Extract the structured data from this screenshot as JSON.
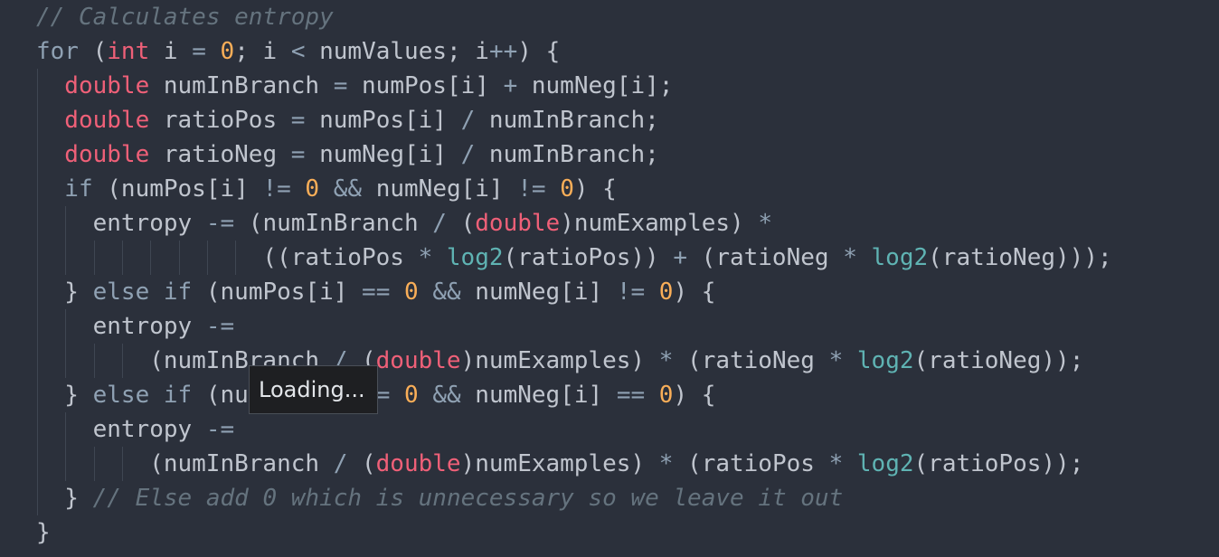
{
  "editor": {
    "colors": {
      "background": "#2b303b",
      "text": "#c0c5ce",
      "keyword": "#8fa1b3",
      "type": "#ef6078",
      "number": "#f9ae58",
      "operator": "#8fa1b3",
      "function": "#5fb3b3",
      "comment": "#65737e"
    },
    "lines": [
      {
        "indent": 0,
        "tokens": [
          {
            "t": "comment",
            "v": "// Calculates entropy"
          }
        ]
      },
      {
        "indent": 0,
        "tokens": [
          {
            "t": "kw",
            "v": "for"
          },
          {
            "t": "text",
            "v": " ("
          },
          {
            "t": "type",
            "v": "int"
          },
          {
            "t": "text",
            "v": " i "
          },
          {
            "t": "op",
            "v": "="
          },
          {
            "t": "text",
            "v": " "
          },
          {
            "t": "num",
            "v": "0"
          },
          {
            "t": "text",
            "v": "; i "
          },
          {
            "t": "op",
            "v": "<"
          },
          {
            "t": "text",
            "v": " numValues; i"
          },
          {
            "t": "op",
            "v": "++"
          },
          {
            "t": "text",
            "v": ") {"
          }
        ]
      },
      {
        "indent": 1,
        "tokens": [
          {
            "t": "type",
            "v": "double"
          },
          {
            "t": "text",
            "v": " numInBranch "
          },
          {
            "t": "op",
            "v": "="
          },
          {
            "t": "text",
            "v": " numPos[i] "
          },
          {
            "t": "op",
            "v": "+"
          },
          {
            "t": "text",
            "v": " numNeg[i];"
          }
        ]
      },
      {
        "indent": 1,
        "tokens": [
          {
            "t": "type",
            "v": "double"
          },
          {
            "t": "text",
            "v": " ratioPos "
          },
          {
            "t": "op",
            "v": "="
          },
          {
            "t": "text",
            "v": " numPos[i] "
          },
          {
            "t": "op",
            "v": "/"
          },
          {
            "t": "text",
            "v": " numInBranch;"
          }
        ]
      },
      {
        "indent": 1,
        "tokens": [
          {
            "t": "type",
            "v": "double"
          },
          {
            "t": "text",
            "v": " ratioNeg "
          },
          {
            "t": "op",
            "v": "="
          },
          {
            "t": "text",
            "v": " numNeg[i] "
          },
          {
            "t": "op",
            "v": "/"
          },
          {
            "t": "text",
            "v": " numInBranch;"
          }
        ]
      },
      {
        "indent": 1,
        "tokens": [
          {
            "t": "kw",
            "v": "if"
          },
          {
            "t": "text",
            "v": " (numPos[i] "
          },
          {
            "t": "op",
            "v": "!="
          },
          {
            "t": "text",
            "v": " "
          },
          {
            "t": "num",
            "v": "0"
          },
          {
            "t": "text",
            "v": " "
          },
          {
            "t": "op",
            "v": "&&"
          },
          {
            "t": "text",
            "v": " numNeg[i] "
          },
          {
            "t": "op",
            "v": "!="
          },
          {
            "t": "text",
            "v": " "
          },
          {
            "t": "num",
            "v": "0"
          },
          {
            "t": "text",
            "v": ") {"
          }
        ]
      },
      {
        "indent": 2,
        "tokens": [
          {
            "t": "text",
            "v": "entropy "
          },
          {
            "t": "op",
            "v": "-="
          },
          {
            "t": "text",
            "v": " (numInBranch "
          },
          {
            "t": "op",
            "v": "/"
          },
          {
            "t": "text",
            "v": " ("
          },
          {
            "t": "type",
            "v": "double"
          },
          {
            "t": "text",
            "v": ")numExamples) "
          },
          {
            "t": "op",
            "v": "*"
          }
        ]
      },
      {
        "indent": 8,
        "tokens": [
          {
            "t": "text",
            "v": "((ratioPos "
          },
          {
            "t": "op",
            "v": "*"
          },
          {
            "t": "text",
            "v": " "
          },
          {
            "t": "fn",
            "v": "log2"
          },
          {
            "t": "text",
            "v": "(ratioPos)) "
          },
          {
            "t": "op",
            "v": "+"
          },
          {
            "t": "text",
            "v": " (ratioNeg "
          },
          {
            "t": "op",
            "v": "*"
          },
          {
            "t": "text",
            "v": " "
          },
          {
            "t": "fn",
            "v": "log2"
          },
          {
            "t": "text",
            "v": "(ratioNeg)));"
          }
        ]
      },
      {
        "indent": 1,
        "tokens": [
          {
            "t": "text",
            "v": "} "
          },
          {
            "t": "kw",
            "v": "else"
          },
          {
            "t": "text",
            "v": " "
          },
          {
            "t": "kw",
            "v": "if"
          },
          {
            "t": "text",
            "v": " (numPos[i] "
          },
          {
            "t": "op",
            "v": "=="
          },
          {
            "t": "text",
            "v": " "
          },
          {
            "t": "num",
            "v": "0"
          },
          {
            "t": "text",
            "v": " "
          },
          {
            "t": "op",
            "v": "&&"
          },
          {
            "t": "text",
            "v": " numNeg[i] "
          },
          {
            "t": "op",
            "v": "!="
          },
          {
            "t": "text",
            "v": " "
          },
          {
            "t": "num",
            "v": "0"
          },
          {
            "t": "text",
            "v": ") {"
          }
        ]
      },
      {
        "indent": 2,
        "tokens": [
          {
            "t": "text",
            "v": "entropy "
          },
          {
            "t": "op",
            "v": "-="
          }
        ]
      },
      {
        "indent": 4,
        "tokens": [
          {
            "t": "text",
            "v": "(numInBranch "
          },
          {
            "t": "op",
            "v": "/"
          },
          {
            "t": "text",
            "v": " ("
          },
          {
            "t": "type",
            "v": "double"
          },
          {
            "t": "text",
            "v": ")numExamples) "
          },
          {
            "t": "op",
            "v": "*"
          },
          {
            "t": "text",
            "v": " (ratioNeg "
          },
          {
            "t": "op",
            "v": "*"
          },
          {
            "t": "text",
            "v": " "
          },
          {
            "t": "fn",
            "v": "log2"
          },
          {
            "t": "text",
            "v": "(ratioNeg));"
          }
        ]
      },
      {
        "indent": 1,
        "tokens": [
          {
            "t": "text",
            "v": "} "
          },
          {
            "t": "kw",
            "v": "else"
          },
          {
            "t": "text",
            "v": " "
          },
          {
            "t": "kw",
            "v": "if"
          },
          {
            "t": "text",
            "v": " (numPos[i] "
          },
          {
            "t": "op",
            "v": "!="
          },
          {
            "t": "text",
            "v": " "
          },
          {
            "t": "num",
            "v": "0"
          },
          {
            "t": "text",
            "v": " "
          },
          {
            "t": "op",
            "v": "&&"
          },
          {
            "t": "text",
            "v": " numNeg[i] "
          },
          {
            "t": "op",
            "v": "=="
          },
          {
            "t": "text",
            "v": " "
          },
          {
            "t": "num",
            "v": "0"
          },
          {
            "t": "text",
            "v": ") {"
          }
        ]
      },
      {
        "indent": 2,
        "tokens": [
          {
            "t": "text",
            "v": "entropy "
          },
          {
            "t": "op",
            "v": "-="
          }
        ]
      },
      {
        "indent": 4,
        "tokens": [
          {
            "t": "text",
            "v": "(numInBranch "
          },
          {
            "t": "op",
            "v": "/"
          },
          {
            "t": "text",
            "v": " ("
          },
          {
            "t": "type",
            "v": "double"
          },
          {
            "t": "text",
            "v": ")numExamples) "
          },
          {
            "t": "op",
            "v": "*"
          },
          {
            "t": "text",
            "v": " (ratioPos "
          },
          {
            "t": "op",
            "v": "*"
          },
          {
            "t": "text",
            "v": " "
          },
          {
            "t": "fn",
            "v": "log2"
          },
          {
            "t": "text",
            "v": "(ratioPos));"
          }
        ]
      },
      {
        "indent": 1,
        "tokens": [
          {
            "t": "text",
            "v": "} "
          },
          {
            "t": "comment",
            "v": "// Else add 0 which is unnecessary so we leave it out"
          }
        ]
      },
      {
        "indent": 0,
        "tokens": [
          {
            "t": "text",
            "v": "}"
          }
        ]
      }
    ]
  },
  "tooltip": {
    "text": "Loading..."
  }
}
